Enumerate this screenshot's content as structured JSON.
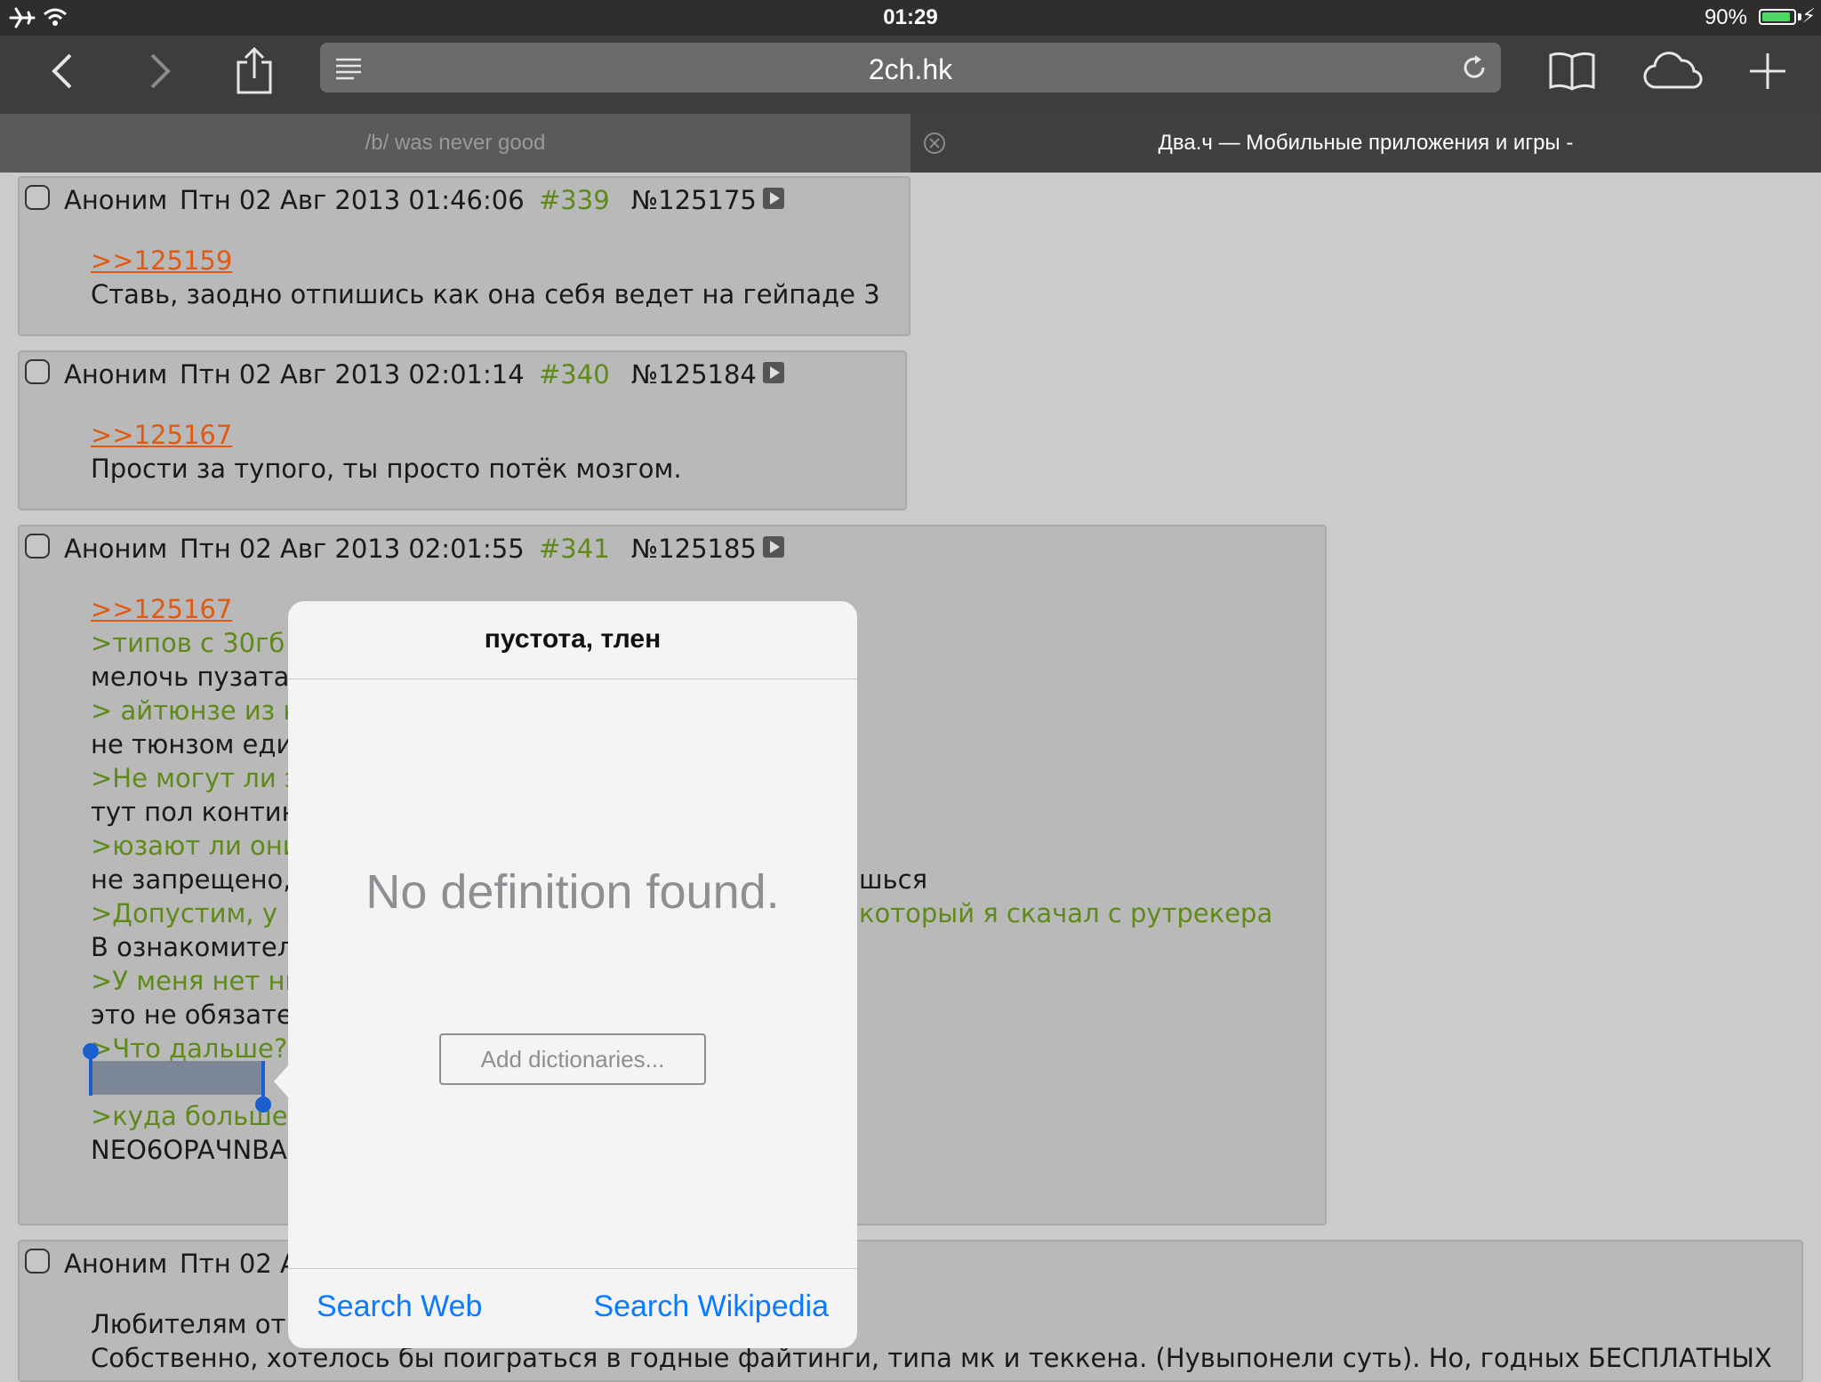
{
  "status": {
    "time": "01:29",
    "battery": "90%",
    "battery_level": 0.9
  },
  "toolbar": {
    "url": "2ch.hk"
  },
  "tabs": [
    {
      "label": "/b/ was never good"
    },
    {
      "label": "Два.ч — Мобильные приложения и игры -"
    }
  ],
  "posts": [
    {
      "author": "Аноним",
      "date": "Птн 02 Авг 2013 01:46:06",
      "index": "#339",
      "number": "№125175",
      "lines": [
        {
          "text": ">>125159",
          "kind": "link"
        },
        {
          "text": "Ставь, заодно отпишись как она себя ведет на гейпаде 3",
          "kind": "text"
        }
      ]
    },
    {
      "author": "Аноним",
      "date": "Птн 02 Авг 2013 02:01:14",
      "index": "#340",
      "number": "№125184",
      "lines": [
        {
          "text": ">>125167",
          "kind": "link"
        },
        {
          "text": "Прости за тупого, ты просто потёк мозгом.",
          "kind": "text"
        }
      ]
    },
    {
      "author": "Аноним",
      "date": "Птн 02 Авг 2013 02:01:55",
      "index": "#341",
      "number": "№125185",
      "lines": [
        {
          "text": ">>125167",
          "kind": "link"
        },
        {
          "text": ">типов с 30гб",
          "kind": "quote"
        },
        {
          "text": "мелочь пузатая",
          "kind": "text"
        },
        {
          "text": "> айтюнзе из к",
          "kind": "quote"
        },
        {
          "text": "не тюнзом един",
          "kind": "text"
        },
        {
          "text": ">Не могут ли э",
          "kind": "quote"
        },
        {
          "text": "тут пол контине",
          "kind": "text"
        },
        {
          "text": ">юзают ли они",
          "kind": "quote"
        },
        {
          "text": "не запрещено,",
          "kind": "text",
          "tail": "шься"
        },
        {
          "text": ">Допустим, у н",
          "kind": "quote",
          "tail": "который я скачал с рутрекера"
        },
        {
          "text": "В ознакомитель",
          "kind": "text"
        },
        {
          "text": ">У меня нет ни",
          "kind": "quote"
        },
        {
          "text": "это не обязател",
          "kind": "text"
        },
        {
          "text": ">Что дальше?",
          "kind": "quote"
        },
        {
          "text": "",
          "kind": "text"
        },
        {
          "text": ">куда больше",
          "kind": "quote"
        },
        {
          "text": "NEO6OPAЧNBAI",
          "kind": "text"
        }
      ]
    },
    {
      "author": "Аноним",
      "date": "Птн 02 А",
      "lines": [
        {
          "text": "Любителям отк",
          "kind": "text"
        },
        {
          "text": "Собственно, хотелось бы поиграться в годные файтинги, типа мк и теккена. (Нувыпонели суть). Но, годных БЕСПЛАТНЫХ",
          "kind": "text"
        }
      ]
    }
  ],
  "popover": {
    "title": "пустота, тлен",
    "message": "No definition found.",
    "add_dictionaries": "Add dictionaries...",
    "search_web": "Search Web",
    "search_wikipedia": "Search Wikipedia"
  }
}
